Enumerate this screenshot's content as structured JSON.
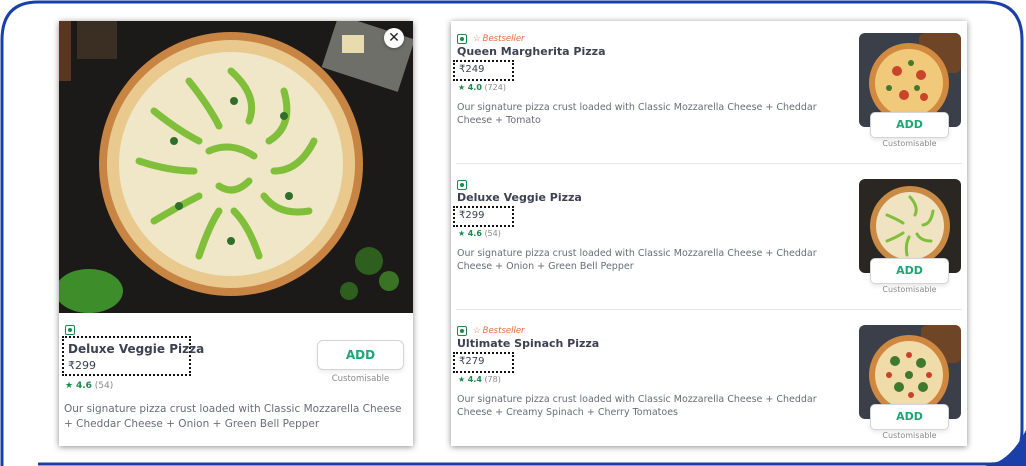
{
  "detail": {
    "name": "Deluxe Veggie Pizza",
    "price": "₹299",
    "rating": "4.6",
    "rating_count": "(54)",
    "description": "Our signature pizza crust loaded with Classic Mozzarella Cheese + Cheddar Cheese + Onion + Green Bell Pepper",
    "add_label": "ADD",
    "customisable": "Customisable",
    "close_icon": "✕"
  },
  "menu": {
    "items": [
      {
        "bestseller": "Bestseller",
        "name": "Queen Margherita Pizza",
        "price": "₹249",
        "rating": "4.0",
        "rating_count": "(724)",
        "description": "Our signature pizza crust loaded with Classic Mozzarella Cheese + Cheddar Cheese + Tomato",
        "add_label": "ADD",
        "customisable": "Customisable"
      },
      {
        "bestseller": "",
        "name": "Deluxe Veggie Pizza",
        "price": "₹299",
        "rating": "4.6",
        "rating_count": "(54)",
        "description": "Our signature pizza crust loaded with Classic Mozzarella Cheese + Cheddar Cheese + Onion + Green Bell Pepper",
        "add_label": "ADD",
        "customisable": "Customisable"
      },
      {
        "bestseller": "Bestseller",
        "name": "Ultimate Spinach Pizza",
        "price": "₹279",
        "rating": "4.4",
        "rating_count": "(78)",
        "description": "Our signature pizza crust loaded with Classic Mozzarella Cheese + Cheddar Cheese + Creamy Spinach + Cherry Tomatoes",
        "add_label": "ADD",
        "customisable": "Customisable"
      }
    ]
  },
  "colors": {
    "veg_green": "#1b8a4d",
    "add_green": "#1ba672",
    "bestseller_orange": "#ee6b3b",
    "frame_blue": "#1a3fa8"
  },
  "icons": {
    "veg": "veg-indicator-icon",
    "star": "star-icon",
    "bestseller_star": "bestseller-star-icon",
    "close": "close-icon"
  }
}
